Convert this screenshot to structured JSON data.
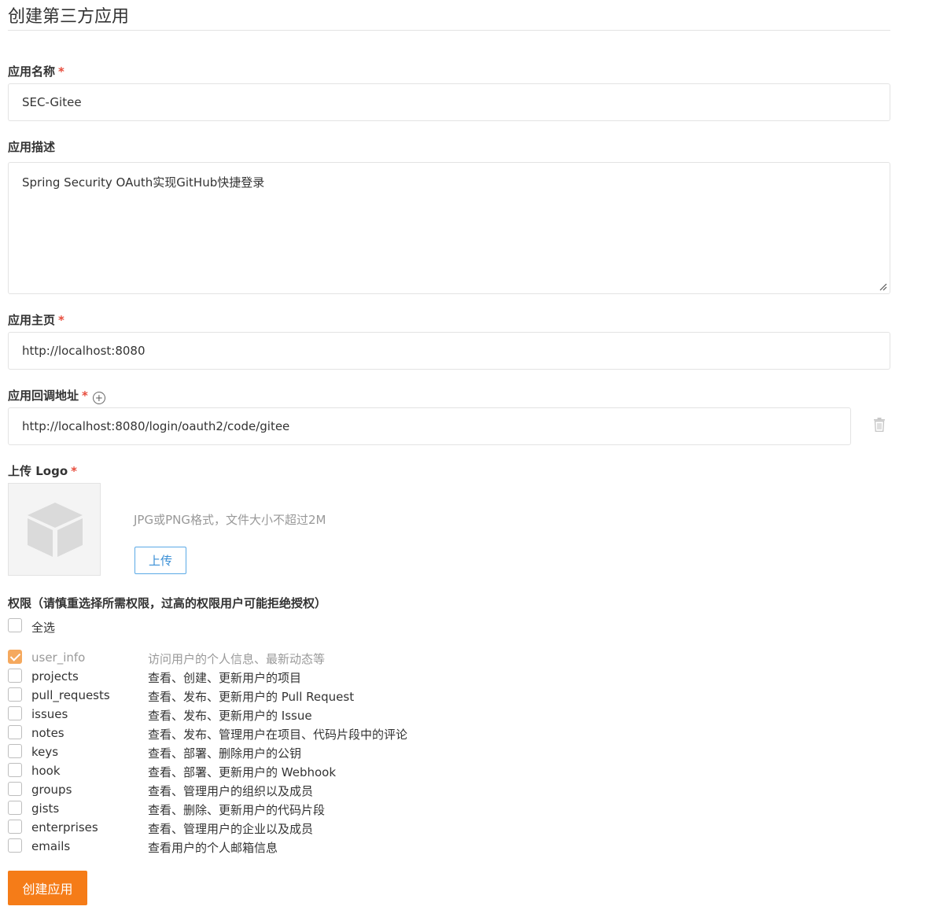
{
  "page": {
    "title": "创建第三方应用"
  },
  "form": {
    "app_name": {
      "label": "应用名称",
      "required_mark": "*",
      "value": "SEC-Gitee"
    },
    "app_desc": {
      "label": "应用描述",
      "value": "Spring Security OAuth实现GitHub快捷登录"
    },
    "homepage": {
      "label": "应用主页",
      "required_mark": "*",
      "value": "http://localhost:8080"
    },
    "callback": {
      "label": "应用回调地址",
      "required_mark": "*",
      "add_icon": "plus-circle-icon",
      "value": "http://localhost:8080/login/oauth2/code/gitee",
      "delete_icon": "trash-icon"
    },
    "logo": {
      "label": "上传 Logo",
      "required_mark": "*",
      "hint": "JPG或PNG格式，文件大小不超过2M",
      "upload_label": "上传",
      "placeholder_icon": "cube-icon"
    }
  },
  "permissions": {
    "title": "权限（请慎重选择所需权限，过高的权限用户可能拒绝授权）",
    "select_all": {
      "label": "全选",
      "checked": false
    },
    "items": [
      {
        "name": "user_info",
        "desc": "访问用户的个人信息、最新动态等",
        "checked": true,
        "disabled": true
      },
      {
        "name": "projects",
        "desc": "查看、创建、更新用户的项目",
        "checked": false
      },
      {
        "name": "pull_requests",
        "desc": "查看、发布、更新用户的 Pull Request",
        "checked": false
      },
      {
        "name": "issues",
        "desc": "查看、发布、更新用户的 Issue",
        "checked": false
      },
      {
        "name": "notes",
        "desc": "查看、发布、管理用户在项目、代码片段中的评论",
        "checked": false
      },
      {
        "name": "keys",
        "desc": "查看、部署、删除用户的公钥",
        "checked": false
      },
      {
        "name": "hook",
        "desc": "查看、部署、更新用户的 Webhook",
        "checked": false
      },
      {
        "name": "groups",
        "desc": "查看、管理用户的组织以及成员",
        "checked": false
      },
      {
        "name": "gists",
        "desc": "查看、删除、更新用户的代码片段",
        "checked": false
      },
      {
        "name": "enterprises",
        "desc": "查看、管理用户的企业以及成员",
        "checked": false
      },
      {
        "name": "emails",
        "desc": "查看用户的个人邮箱信息",
        "checked": false
      }
    ]
  },
  "submit": {
    "label": "创建应用"
  },
  "colors": {
    "accent": "#f57c18",
    "required": "#e74c3c",
    "link_blue": "#3a8fd6",
    "checkbox_checked": "#f5a95e"
  }
}
